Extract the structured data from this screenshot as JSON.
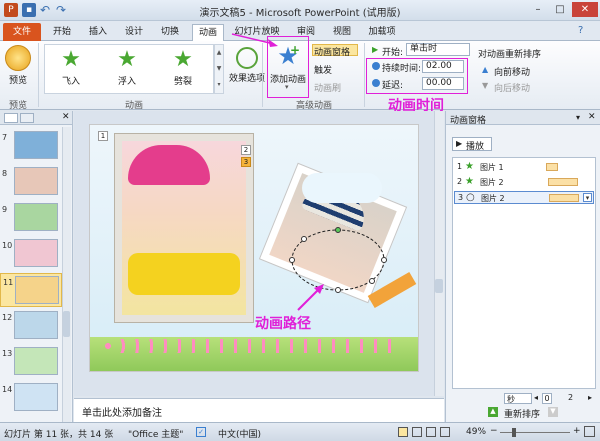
{
  "window": {
    "title": "演示文稿5 - Microsoft PowerPoint (试用版)"
  },
  "tabs": [
    "文件",
    "开始",
    "插入",
    "设计",
    "切换",
    "动画",
    "幻灯片放映",
    "审阅",
    "视图",
    "加载项"
  ],
  "ribbon": {
    "preview_label": "预览",
    "preview_group": "预览",
    "effects": [
      "飞入",
      "浮入",
      "劈裂"
    ],
    "anim_group": "动画",
    "effect_options": "效果选项",
    "add_animation": "添加动画",
    "advanced_group": "高级动画",
    "anim_pane_btn": "动画窗格",
    "trigger_btn": "触发",
    "anim_painter_btn": "动画刷",
    "start_label": "开始:",
    "start_value": "单击时",
    "duration_label": "持续时间:",
    "duration_value": "02.00",
    "delay_label": "延迟:",
    "delay_value": "00.00",
    "reorder_label": "对动画重新排序",
    "move_earlier": "向前移动",
    "move_later": "向后移动"
  },
  "annotations": {
    "timing": "动画时间",
    "path": "动画路径"
  },
  "slides": [
    {
      "num": "7",
      "color": "#7fb0d9"
    },
    {
      "num": "8",
      "color": "#e7c7b8"
    },
    {
      "num": "9",
      "color": "#a9d6a0"
    },
    {
      "num": "10",
      "color": "#f0c6d2"
    },
    {
      "num": "11",
      "color": "#f5d38a",
      "selected": true
    },
    {
      "num": "12",
      "color": "#bcd7ea"
    },
    {
      "num": "13",
      "color": "#c4e6b8"
    },
    {
      "num": "14",
      "color": "#cfe3f3"
    }
  ],
  "slide_badges": [
    "1",
    "2",
    "3"
  ],
  "notes_placeholder": "单击此处添加备注",
  "anim_pane": {
    "title": "动画窗格",
    "play_label": "播放",
    "items": [
      {
        "index": "1",
        "name": "图片 1"
      },
      {
        "index": "2",
        "name": "图片 2"
      },
      {
        "index": "3",
        "name": "图片 2"
      }
    ],
    "seconds_label": "秒",
    "page_a": "0",
    "page_b": "2",
    "reorder": "重新排序"
  },
  "status": {
    "slide_info": "幻灯片 第 11 张，共 14 张",
    "theme": "\"Office 主题\"",
    "language": "中文(中国)",
    "zoom": "49%"
  },
  "colors": {
    "accent": "#e020d8",
    "file_tab": "#d9541e"
  }
}
